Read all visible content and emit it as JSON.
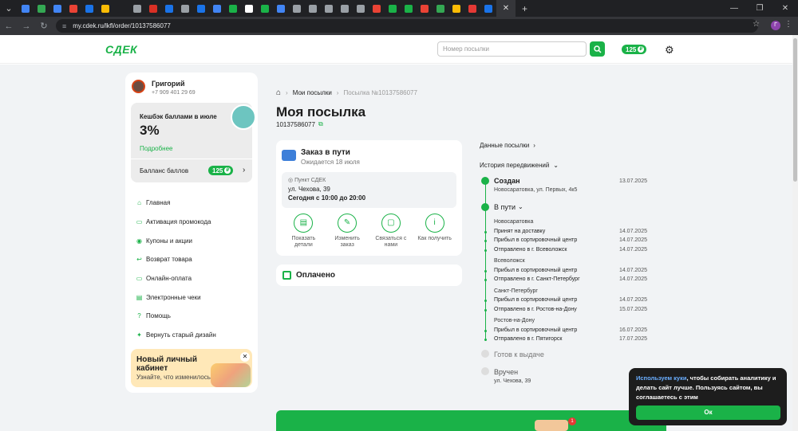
{
  "browser": {
    "url": "my.cdek.ru/lkfl/order/10137586077",
    "tab_close": "✕",
    "new_tab": "+",
    "tab_colors": [
      "#4285f4",
      "#34a853",
      "#4285f4",
      "#ea4335",
      "#1a73e8",
      "#fbbc05",
      "#202124",
      "#9aa0a6",
      "#d93025",
      "#1a73e8",
      "#9aa0a6",
      "#1a73e8",
      "#4285f4",
      "#1ab248",
      "#ffffff",
      "#1ab248",
      "#4285f4",
      "#9aa0a6",
      "#9aa0a6",
      "#9aa0a6",
      "#9aa0a6",
      "#9aa0a6",
      "#ea4335",
      "#1ab248",
      "#1ab248",
      "#ea4335",
      "#34a853",
      "#fbbc05",
      "#e53935",
      "#1a73e8"
    ],
    "profile_initial": "Г"
  },
  "header": {
    "logo": "СДЕК",
    "search_placeholder": "Номер посылки",
    "points": "125",
    "currency_sign": "₽"
  },
  "user": {
    "name": "Григорий",
    "phone": "+7 909 401 29 69"
  },
  "cashback": {
    "title": "Кешбэк баллами в июле",
    "percent": "3%",
    "more": "Подробнее",
    "balance_label": "Балланс баллов",
    "balance": "125"
  },
  "nav": [
    {
      "icon": "home-icon",
      "label": "Главная"
    },
    {
      "icon": "promo-icon",
      "label": "Активация промокода"
    },
    {
      "icon": "coupon-icon",
      "label": "Купоны и акции"
    },
    {
      "icon": "return-icon",
      "label": "Возврат товара"
    },
    {
      "icon": "card-icon",
      "label": "Онлайн-оплата"
    },
    {
      "icon": "receipt-icon",
      "label": "Электронные чеки"
    },
    {
      "icon": "help-icon",
      "label": "Помощь"
    },
    {
      "icon": "design-icon",
      "label": "Вернуть старый дизайн"
    }
  ],
  "promo": {
    "title": "Новый личный кабинет",
    "subtitle": "Узнайте, что изменилось"
  },
  "breadcrumb": {
    "item1": "Мои посылки",
    "item2": "Посылка №10137586077"
  },
  "page": {
    "title": "Моя посылка",
    "order_number": "10137586077"
  },
  "status": {
    "title": "Заказ в пути",
    "expected": "Ожидается 18 июля",
    "pvz_label": "Пункт СДЕК",
    "address": "ул. Чехова, 39",
    "hours": "Сегодня с 10:00 до 20:00"
  },
  "actions": [
    {
      "icon": "document-icon",
      "label": "Показать детали"
    },
    {
      "icon": "edit-icon",
      "label": "Изменить заказ"
    },
    {
      "icon": "chat-icon",
      "label": "Связаться с нами"
    },
    {
      "icon": "info-icon",
      "label": "Как получить"
    }
  ],
  "paid": "Оплачено",
  "details_link": "Данные посылки",
  "history_label": "История передвижений",
  "timeline": {
    "created": {
      "label": "Создан",
      "date": "13.07.2025",
      "address": "Новосаратовка, ул. Первых, 4к5"
    },
    "in_transit": {
      "label": "В пути"
    },
    "groups": [
      {
        "city": "Новосаратовка",
        "events": [
          {
            "text": "Принят на доставку",
            "date": "14.07.2025"
          },
          {
            "text": "Прибыл в сортировочный центр",
            "date": "14.07.2025"
          },
          {
            "text": "Отправлено в г. Всеволожск",
            "date": "14.07.2025"
          }
        ]
      },
      {
        "city": "Всеволожск",
        "events": [
          {
            "text": "Прибыл в сортировочный центр",
            "date": "14.07.2025"
          },
          {
            "text": "Отправлено в г. Санкт-Петербург",
            "date": "14.07.2025"
          }
        ]
      },
      {
        "city": "Санкт-Петербург",
        "events": [
          {
            "text": "Прибыл в сортировочный центр",
            "date": "14.07.2025"
          },
          {
            "text": "Отправлено в г. Ростов-на-Дону",
            "date": "15.07.2025"
          }
        ]
      },
      {
        "city": "Ростов-на-Дону",
        "events": [
          {
            "text": "Прибыл в сортировочный центр",
            "date": "16.07.2025"
          },
          {
            "text": "Отправлено в г. Пятигорск",
            "date": "17.07.2025"
          }
        ]
      }
    ],
    "ready": {
      "label": "Готов к выдаче"
    },
    "delivered": {
      "label": "Вручен",
      "address": "ул. Чехова, 39"
    }
  },
  "cookie": {
    "link": "Используем куки",
    "text": ", чтобы собирать аналитику и делать сайт лучше. Пользуясь сайтом, вы соглашаетесь с этим",
    "ok": "Ок"
  },
  "banner_badge": "1",
  "colors": {
    "brand": "#1ab248",
    "dark": "#1d1d1d"
  }
}
